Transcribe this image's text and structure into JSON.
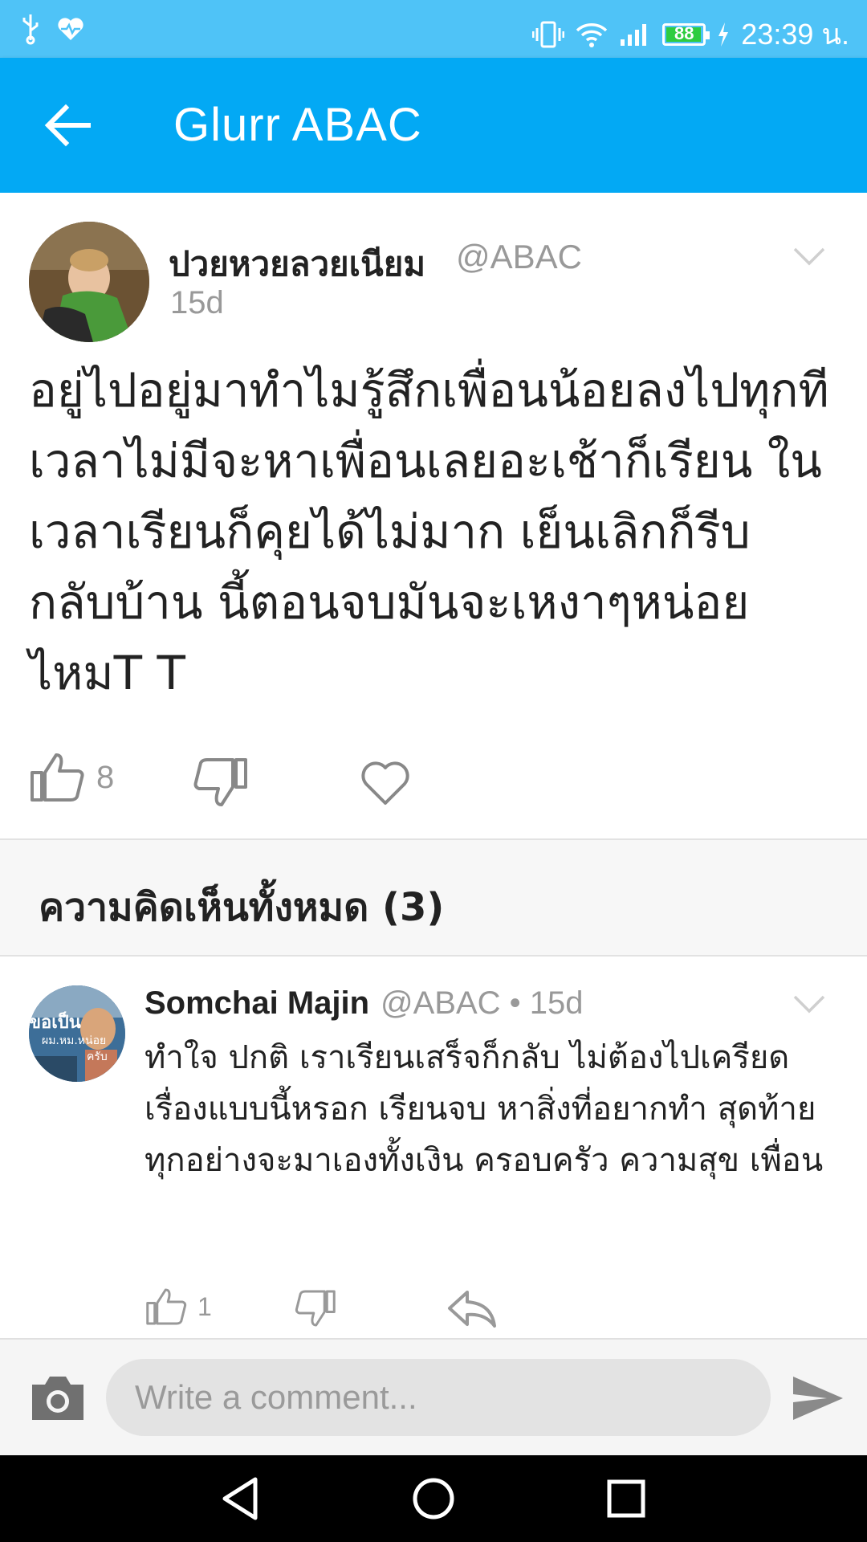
{
  "status_bar": {
    "time": "23:39 น.",
    "battery_level": "88",
    "left_icons": [
      "usb-icon",
      "heart-pulse-icon"
    ],
    "right_icons": [
      "vibrate-icon",
      "wifi-icon",
      "signal-icon",
      "battery-icon",
      "charging-icon"
    ]
  },
  "app_bar": {
    "title": "Glurr ABAC",
    "back_icon": "arrow-left-icon",
    "background": "#03a9f4"
  },
  "post": {
    "author": "ปวยหวยลวยเนียม",
    "handle": "@ABAC",
    "time": "15d",
    "body": "อยู่ไปอยู่มาทำไมรู้สึกเพื่อนน้อยลงไปทุกที เวลาไม่มีจะหาเพื่อนเลยอะเช้าก็เรียน ในเวลาเรียนก็คุยได้ไม่มาก เย็นเลิกก็รีบกลับบ้าน นี้ตอนจบมันจะเหงาๆหน่อยไหมT T",
    "likes": "8",
    "icons": [
      "thumbs-up-icon",
      "thumbs-down-icon",
      "heart-icon",
      "chevron-down-icon"
    ]
  },
  "comments_section": {
    "title": "ความคิดเห็นทั้งหมด (3)"
  },
  "comment": {
    "author": "Somchai Majin",
    "meta": "@ABAC • 15d",
    "body": "ทำใจ ปกติ เราเรียนเสร็จก็กลับ ไม่ต้องไปเครียดเรื่องแบบนี้หรอก เรียนจบ หาสิ่งที่อยากทำ สุดท้ายทุกอย่างจะมาเองทั้งเงิน ครอบครัว ความสุข เพื่อน",
    "likes": "1",
    "avatar_text_1": "ขอเป็น",
    "avatar_text_2": "ผม.หม.หน่อย",
    "avatar_text_3": "ครับ",
    "icons": [
      "thumbs-up-icon",
      "thumbs-down-icon",
      "reply-icon",
      "chevron-down-icon"
    ]
  },
  "composer": {
    "placeholder": "Write a comment...",
    "icons": [
      "camera-icon",
      "send-icon"
    ]
  },
  "nav_bar": {
    "icons": [
      "back-triangle-icon",
      "home-circle-icon",
      "recents-square-icon"
    ]
  }
}
